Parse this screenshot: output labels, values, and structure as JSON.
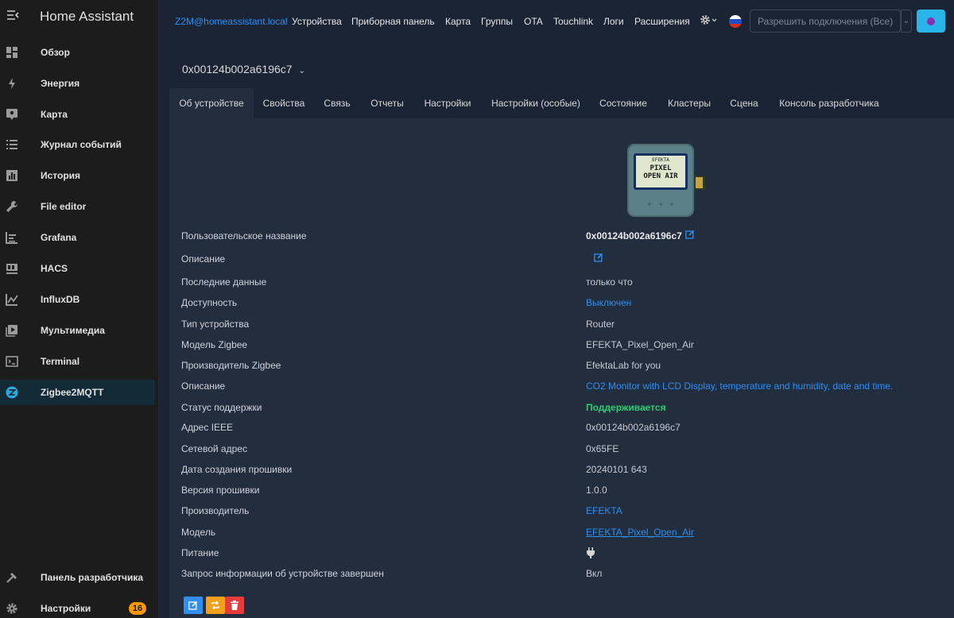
{
  "sidebar": {
    "title": "Home Assistant",
    "items": [
      {
        "label": "Обзор",
        "icon": "dashboard-icon"
      },
      {
        "label": "Энергия",
        "icon": "lightning-icon"
      },
      {
        "label": "Карта",
        "icon": "map-pin-icon"
      },
      {
        "label": "Журнал событий",
        "icon": "list-icon"
      },
      {
        "label": "История",
        "icon": "bar-chart-icon"
      },
      {
        "label": "File editor",
        "icon": "wrench-icon"
      },
      {
        "label": "Grafana",
        "icon": "chart-box-icon"
      },
      {
        "label": "HACS",
        "icon": "hacs-icon"
      },
      {
        "label": "InfluxDB",
        "icon": "line-chart-icon"
      },
      {
        "label": "Мультимедиа",
        "icon": "play-icon"
      },
      {
        "label": "Terminal",
        "icon": "terminal-icon"
      },
      {
        "label": "Zigbee2MQTT",
        "icon": "zigbee-icon"
      }
    ],
    "bottom": [
      {
        "label": "Панель разработчика",
        "icon": "hammer-icon"
      },
      {
        "label": "Настройки",
        "icon": "gear-icon",
        "badge": "16"
      }
    ]
  },
  "topnav": {
    "brand": "Z2M@homeassistant.local",
    "items": [
      "Устройства",
      "Приборная панель",
      "Карта",
      "Группы",
      "OTA",
      "Touchlink",
      "Логи",
      "Расширения"
    ],
    "permit_label": "Разрешить подключения (Все)"
  },
  "device": {
    "title": "0x00124b002a6196c7",
    "tabs": [
      "Об устройстве",
      "Свойства",
      "Связь",
      "Отчеты",
      "Настройки",
      "Настройки (особые)",
      "Состояние",
      "Кластеры",
      "Сцена",
      "Консоль разработчика"
    ],
    "image_text": {
      "brand": "EFEKTA",
      "line1": "PIXEL",
      "line2": "OPEN AIR"
    },
    "info": [
      {
        "k": "Пользовательское название",
        "v": "0x00124b002a6196c7"
      },
      {
        "k": "Описание",
        "v": ""
      },
      {
        "k": "Последние данные",
        "v": "только что"
      },
      {
        "k": "Доступность",
        "v": "Выключен"
      },
      {
        "k": "Тип устройства",
        "v": "Router"
      },
      {
        "k": "Модель Zigbee",
        "v": "EFEKTA_Pixel_Open_Air"
      },
      {
        "k": "Производитель Zigbee",
        "v": "EfektaLab for you"
      },
      {
        "k": "Описание",
        "v": "CO2 Monitor with LCD Display, temperature and humidity, date and time."
      },
      {
        "k": "Статус поддержки",
        "v": "Поддерживается"
      },
      {
        "k": "Адрес IEEE",
        "v": "0x00124b002a6196c7"
      },
      {
        "k": "Сетевой адрес",
        "v": "0x65FE"
      },
      {
        "k": "Дата создания прошивки",
        "v": "20240101 643"
      },
      {
        "k": "Версия прошивки",
        "v": "1.0.0"
      },
      {
        "k": "Производитель",
        "v": "EFEKTA"
      },
      {
        "k": "Модель",
        "v": "EFEKTA_Pixel_Open_Air"
      },
      {
        "k": "Питание",
        "v": ""
      },
      {
        "k": "Запрос информации об устройстве завершен",
        "v": "Вкл"
      }
    ]
  },
  "colors": {
    "accent": "#2f8ef0",
    "active_bg": "#122b37",
    "badge": "#ff9800",
    "ok": "#2ecc71"
  }
}
